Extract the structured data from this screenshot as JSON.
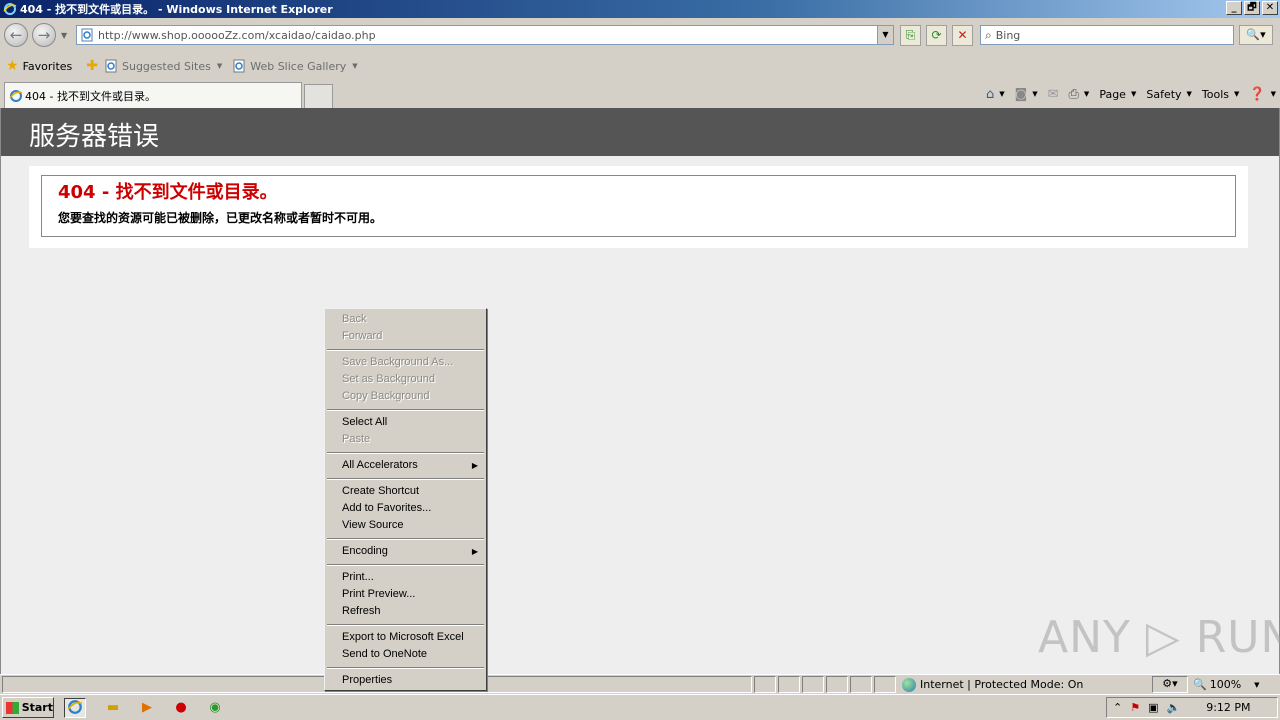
{
  "window": {
    "title": "404 - 找不到文件或目录。 - Windows Internet Explorer",
    "controls": [
      "_",
      "🗗",
      "✕"
    ]
  },
  "address_bar": {
    "url": "http://www.shop.oooooZz.com/xcaidao/caidao.php",
    "search_placeholder": "Bing"
  },
  "favorites_bar": {
    "favorites_label": "Favorites",
    "suggested_sites_label": "Suggested Sites",
    "web_slice_gallery_label": "Web Slice Gallery"
  },
  "tab": {
    "label": "404 - 找不到文件或目录。"
  },
  "command_bar": {
    "page_label": "Page",
    "safety_label": "Safety",
    "tools_label": "Tools"
  },
  "page": {
    "header_title": "服务器错误",
    "error_heading": "404 - 找不到文件或目录。",
    "error_message": "您要查找的资源可能已被删除，已更改名称或者暂时不可用。"
  },
  "context_menu": {
    "groups": [
      [
        {
          "label": "Back",
          "enabled": false
        },
        {
          "label": "Forward",
          "enabled": false
        }
      ],
      [
        {
          "label": "Save Background As...",
          "enabled": false
        },
        {
          "label": "Set as Background",
          "enabled": false
        },
        {
          "label": "Copy Background",
          "enabled": false
        }
      ],
      [
        {
          "label": "Select All",
          "enabled": true
        },
        {
          "label": "Paste",
          "enabled": false
        }
      ],
      [
        {
          "label": "All Accelerators",
          "enabled": true,
          "submenu": true
        }
      ],
      [
        {
          "label": "Create Shortcut",
          "enabled": true
        },
        {
          "label": "Add to Favorites...",
          "enabled": true
        },
        {
          "label": "View Source",
          "enabled": true
        }
      ],
      [
        {
          "label": "Encoding",
          "enabled": true,
          "submenu": true
        }
      ],
      [
        {
          "label": "Print...",
          "enabled": true
        },
        {
          "label": "Print Preview...",
          "enabled": true
        },
        {
          "label": "Refresh",
          "enabled": true
        }
      ],
      [
        {
          "label": "Export to Microsoft Excel",
          "enabled": true
        },
        {
          "label": "Send to OneNote",
          "enabled": true
        }
      ],
      [
        {
          "label": "Properties",
          "enabled": true
        }
      ]
    ]
  },
  "status_bar": {
    "zone_text": "Internet | Protected Mode: On",
    "zoom": "100%"
  },
  "taskbar": {
    "start_label": "Start",
    "clock": "9:12 PM"
  },
  "watermark": "ANY ▷ RUN"
}
